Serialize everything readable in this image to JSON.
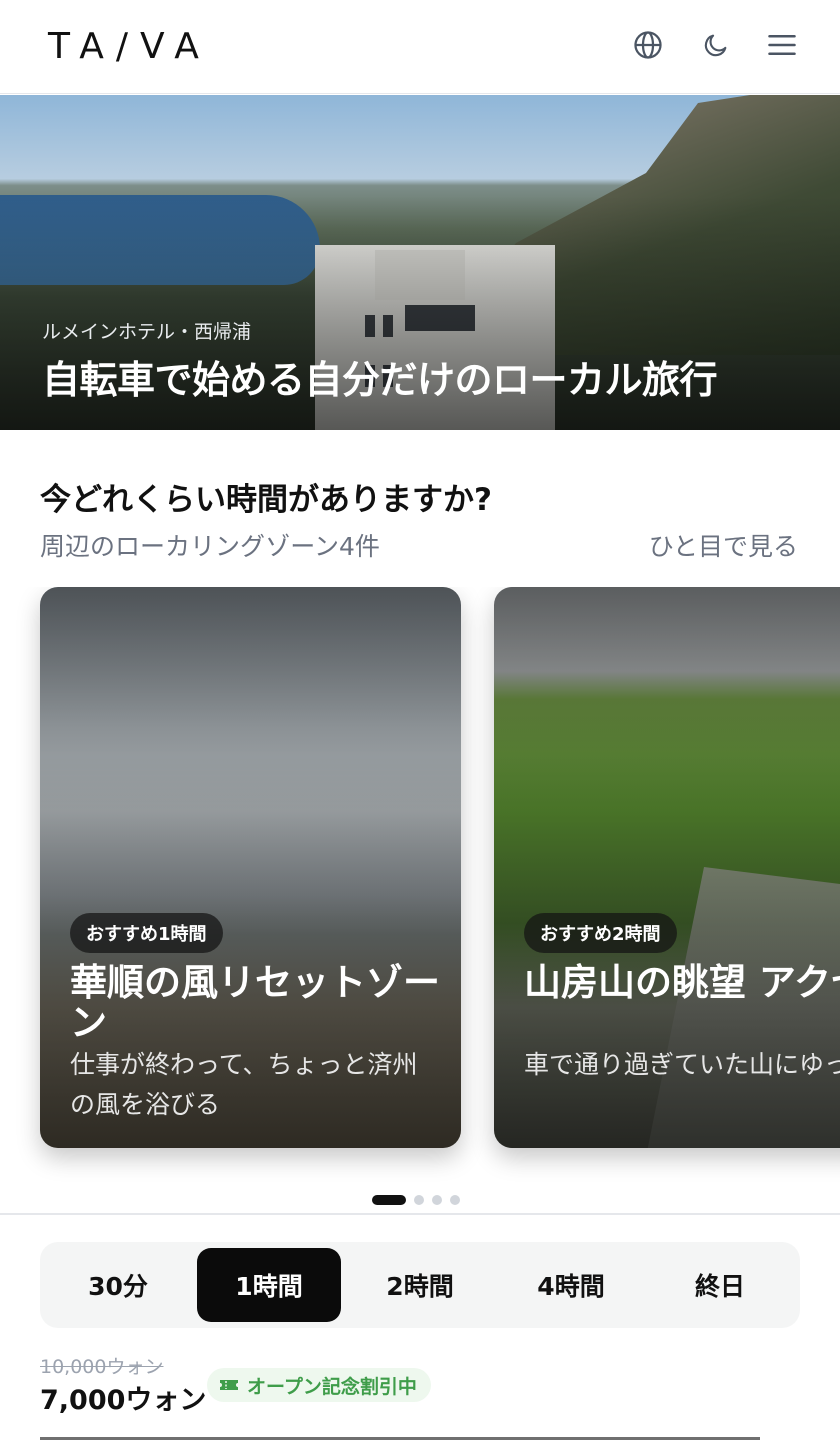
{
  "header": {
    "logo": "TA/VA",
    "icons": [
      "globe-icon",
      "moon-icon",
      "menu-icon"
    ]
  },
  "hero": {
    "subtitle": "ルメインホテル・西帰浦",
    "title": "自転車で始める自分だけのローカル旅行"
  },
  "section": {
    "title": "今どれくらい時間がありますか?",
    "subtitle": "周辺のローカリングゾーン4件",
    "link": "ひと目で見る"
  },
  "cards": [
    {
      "badge": "おすすめ1時間",
      "title": "華順の風リセットゾーン",
      "description": "仕事が終わって、ちょっと済州の風を浴びる"
    },
    {
      "badge": "おすすめ2時間",
      "title": "山房山の眺望 アクセスゾーン",
      "description": "車で通り過ぎていた山にゆっくりと向き合う"
    }
  ],
  "carousel": {
    "page_count": 4,
    "active_index": 0
  },
  "durations": [
    "30分",
    "1時間",
    "2時間",
    "4時間",
    "終日"
  ],
  "selected_duration": "1時間",
  "price": {
    "original": "10,000ウォン",
    "current": "7,000ウォン",
    "promo": "オープン記念割引中",
    "promo_color": "#3f9d4a"
  }
}
